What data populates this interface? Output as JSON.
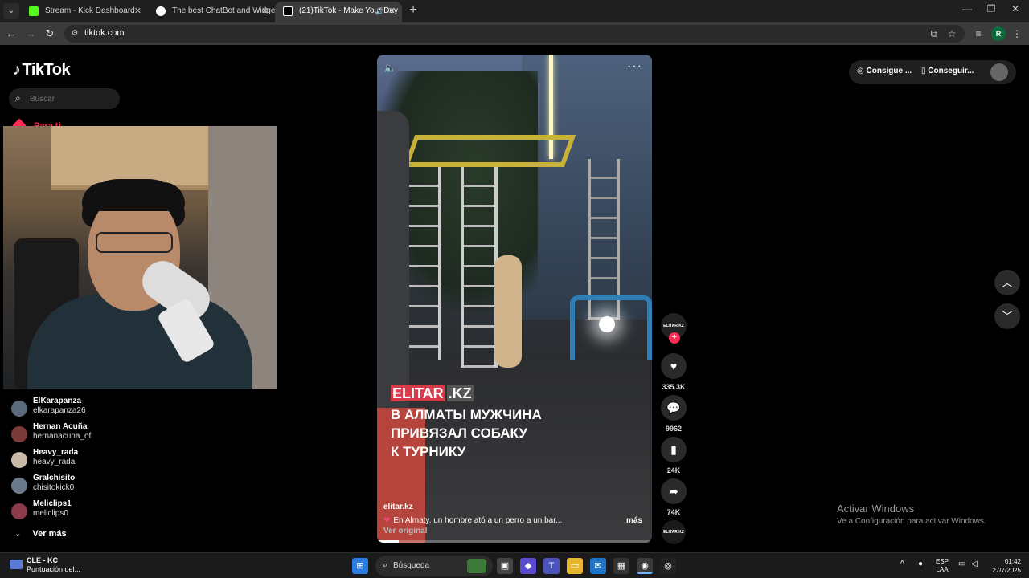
{
  "browser": {
    "tabs": [
      {
        "title": "Stream - Kick Dashboard",
        "favicon_color": "#53fc18"
      },
      {
        "title": "The best ChatBot and Widgets",
        "favicon_color": "#ffffff"
      },
      {
        "title": "(21)TikTok - Make Your Day",
        "favicon_color": "#ffffff"
      }
    ],
    "url": "tiktok.com"
  },
  "sidebar": {
    "logo": "TikTok",
    "search_placeholder": "Buscar",
    "for_you": "Para ti",
    "accounts": [
      {
        "name": "ElKarapanza",
        "handle": "elkarapanza26"
      },
      {
        "name": "Hernan Acuña",
        "handle": "hernanacuna_of"
      },
      {
        "name": "Heavy_rada",
        "handle": "heavy_rada"
      },
      {
        "name": "Gralchisito",
        "handle": "chisitokick0"
      },
      {
        "name": "Meliclips1",
        "handle": "meliclips0"
      }
    ],
    "see_more": "Ver más"
  },
  "video": {
    "brand_a": "ELITAR",
    "brand_b": ".KZ",
    "headline_1": "В АЛМАТЫ МУЖЧИНА",
    "headline_2": "ПРИВЯЗАЛ СОБАКУ",
    "headline_3": "К ТУРНИКУ",
    "author": "elitar.kz",
    "caption": "En Almaty, un hombre ató a un perro a un bar...",
    "more": "más",
    "see_original": "Ver original",
    "progress_fraction": 0.08,
    "channel_badge": "ELITAR.KZ"
  },
  "actions": {
    "likes": "335.3K",
    "comments": "9962",
    "saves": "24K",
    "shares": "74K"
  },
  "header_right": {
    "get_coins": "Consigue ...",
    "get_app": "Conseguir..."
  },
  "watermark": {
    "line1": "Activar Windows",
    "line2": "Ve a Configuración para activar Windows."
  },
  "taskbar": {
    "widget_line1": "CLE - KC",
    "widget_line2": "Puntuación del...",
    "search": "Búsqueda",
    "lang1": "ESP",
    "lang2": "LAA",
    "time": "01:42",
    "date": "27/7/2025"
  }
}
